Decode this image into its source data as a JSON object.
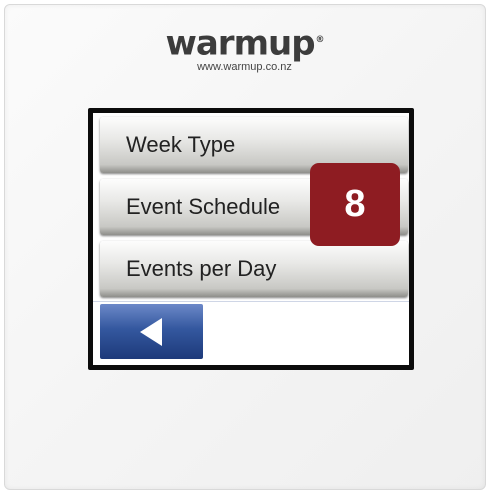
{
  "branding": {
    "logo": "warmup",
    "trademark": "®",
    "website": "www.warmup.co.nz"
  },
  "menu": {
    "items": [
      {
        "label": "Week Type"
      },
      {
        "label": "Event Schedule"
      },
      {
        "label": "Events per Day"
      }
    ],
    "back_icon": "back-arrow-icon"
  },
  "callout": {
    "number": "8",
    "color": "#8e1c22"
  }
}
